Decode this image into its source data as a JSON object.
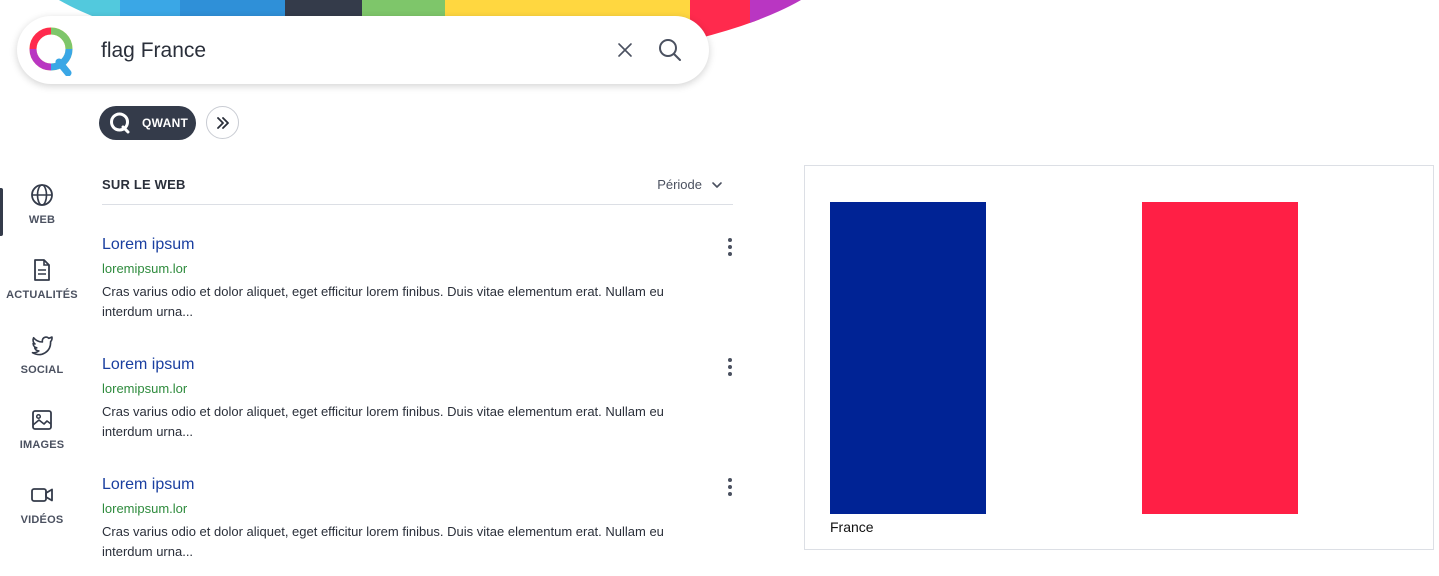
{
  "search": {
    "query": "flag France",
    "clear_icon": "close-icon",
    "submit_icon": "search-icon"
  },
  "brand": {
    "logo_icon": "qwant-logo",
    "pill_label": "QWANT",
    "more_icon": "double-chevron-right-icon"
  },
  "nav": {
    "items": [
      {
        "label": "WEB",
        "icon": "globe-icon",
        "active": true
      },
      {
        "label": "ACTUALITÉS",
        "icon": "document-icon",
        "active": false
      },
      {
        "label": "SOCIAL",
        "icon": "twitter-icon",
        "active": false
      },
      {
        "label": "IMAGES",
        "icon": "image-icon",
        "active": false
      },
      {
        "label": "VIDÉOS",
        "icon": "video-icon",
        "active": false
      }
    ]
  },
  "results": {
    "section_title": "SUR LE WEB",
    "period_label": "Période",
    "items": [
      {
        "title": "Lorem ipsum",
        "url": "loremipsum.lor",
        "snippet": "Cras varius odio et dolor aliquet, eget efficitur lorem finibus. Duis vitae elementum erat. Nullam eu interdum urna..."
      },
      {
        "title": "Lorem ipsum",
        "url": "loremipsum.lor",
        "snippet": "Cras varius odio et dolor aliquet, eget efficitur lorem finibus. Duis vitae elementum erat. Nullam eu interdum urna..."
      },
      {
        "title": "Lorem ipsum",
        "url": "loremipsum.lor",
        "snippet": "Cras varius odio et dolor aliquet, eget efficitur lorem finibus. Duis vitae elementum erat. Nullam eu interdum urna..."
      }
    ]
  },
  "panel": {
    "caption": "France",
    "flag_colors": {
      "blue": "#002395",
      "white": "#ffffff",
      "red": "#ff1f45"
    }
  },
  "colors": {
    "link": "#1a3fa0",
    "url": "#2e8b3d",
    "dark": "#343b4a"
  }
}
